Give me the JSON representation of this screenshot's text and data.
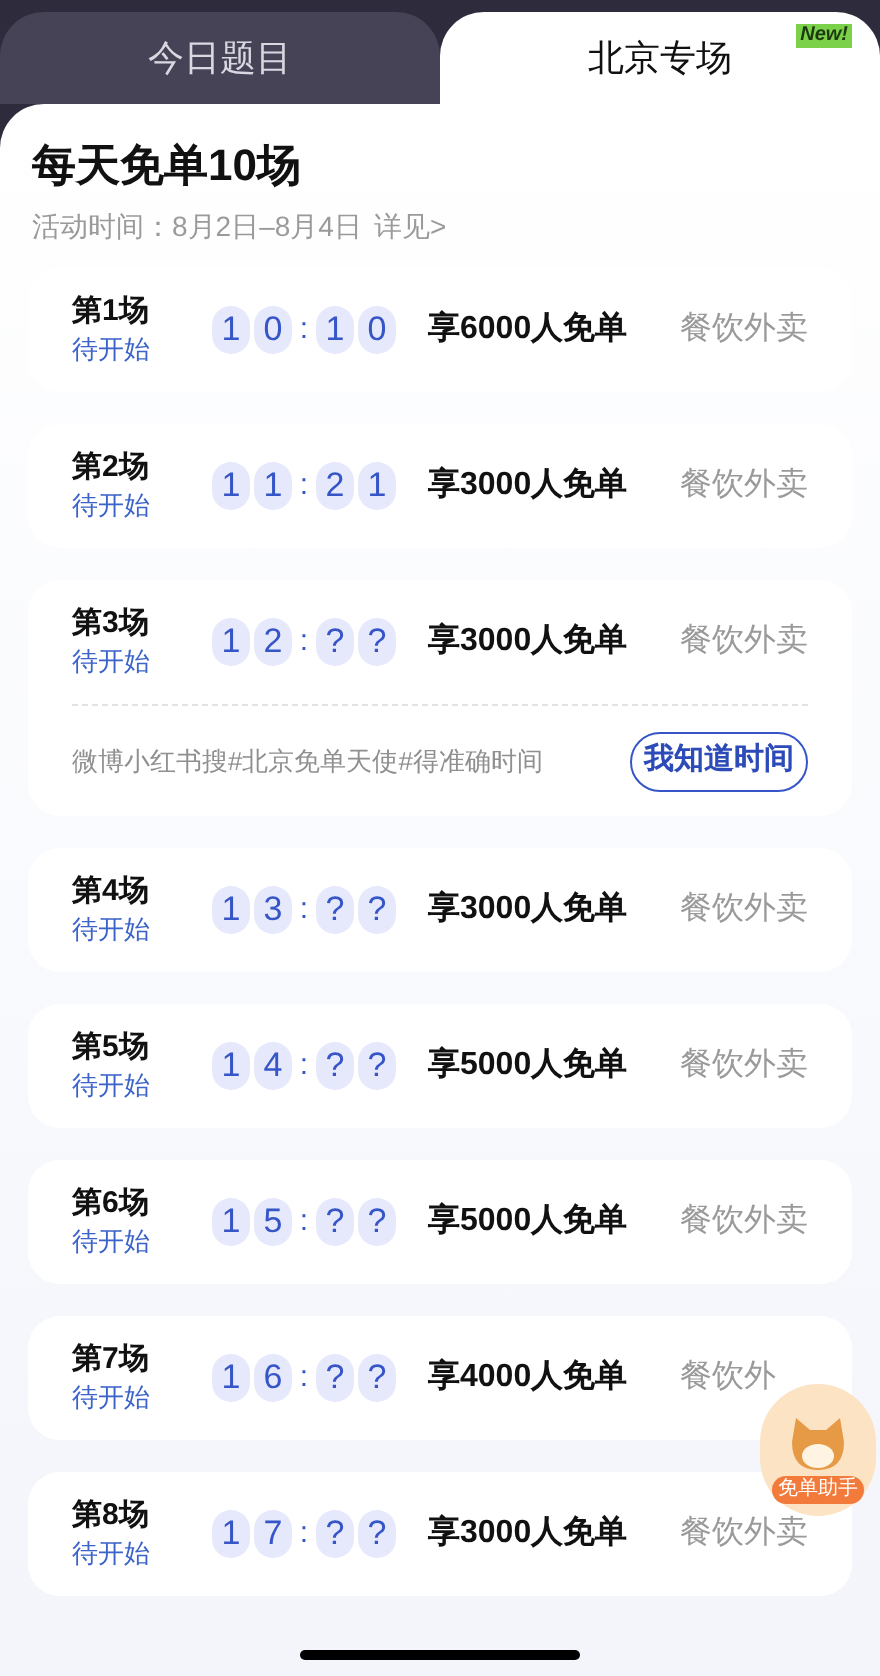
{
  "tabs": [
    {
      "label": "今日题目",
      "selected": false
    },
    {
      "label": "北京专场",
      "selected": true,
      "badge": "New!"
    }
  ],
  "header": {
    "title": "每天免单10场",
    "period": "活动时间：8月2日–8月4日",
    "details_link": "详见>"
  },
  "sessions": [
    {
      "name": "第1场",
      "status": "待开始",
      "hour": [
        "1",
        "0"
      ],
      "sep": ":",
      "minute": [
        "1",
        "0"
      ],
      "offer": "享6000人免单",
      "category": "餐饮外卖"
    },
    {
      "name": "第2场",
      "status": "待开始",
      "hour": [
        "1",
        "1"
      ],
      "sep": ":",
      "minute": [
        "2",
        "1"
      ],
      "offer": "享3000人免单",
      "category": "餐饮外卖"
    },
    {
      "name": "第3场",
      "status": "待开始",
      "hour": [
        "1",
        "2"
      ],
      "sep": ":",
      "minute": [
        "?",
        "?"
      ],
      "offer": "享3000人免单",
      "category": "餐饮外卖",
      "hint": "微博小红书搜#北京免单天使#得准确时间",
      "action": "我知道时间"
    },
    {
      "name": "第4场",
      "status": "待开始",
      "hour": [
        "1",
        "3"
      ],
      "sep": ":",
      "minute": [
        "?",
        "?"
      ],
      "offer": "享3000人免单",
      "category": "餐饮外卖"
    },
    {
      "name": "第5场",
      "status": "待开始",
      "hour": [
        "1",
        "4"
      ],
      "sep": ":",
      "minute": [
        "?",
        "?"
      ],
      "offer": "享5000人免单",
      "category": "餐饮外卖"
    },
    {
      "name": "第6场",
      "status": "待开始",
      "hour": [
        "1",
        "5"
      ],
      "sep": ":",
      "minute": [
        "?",
        "?"
      ],
      "offer": "享5000人免单",
      "category": "餐饮外卖"
    },
    {
      "name": "第7场",
      "status": "待开始",
      "hour": [
        "1",
        "6"
      ],
      "sep": ":",
      "minute": [
        "?",
        "?"
      ],
      "offer": "享4000人免单",
      "category": "餐饮外"
    },
    {
      "name": "第8场",
      "status": "待开始",
      "hour": [
        "1",
        "7"
      ],
      "sep": ":",
      "minute": [
        "?",
        "?"
      ],
      "offer": "享3000人免单",
      "category": "餐饮外卖"
    }
  ],
  "assistant": {
    "label": "免单助手"
  }
}
